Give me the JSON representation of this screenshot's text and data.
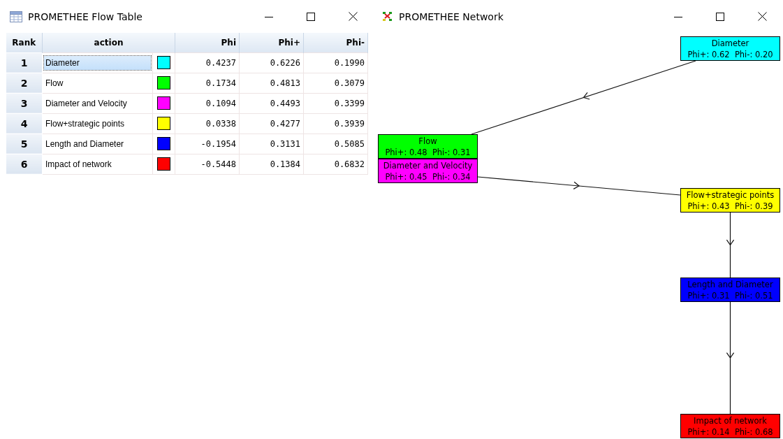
{
  "flow_window": {
    "title": "PROMETHEE Flow Table",
    "table": {
      "columns": [
        "Rank",
        "action",
        "Phi",
        "Phi+",
        "Phi-"
      ],
      "rows": [
        {
          "rank": "1",
          "action": "Diameter",
          "color": "#00ffff",
          "phi": "0.4237",
          "phi_plus": "0.6226",
          "phi_minus": "0.1990",
          "selected": true
        },
        {
          "rank": "2",
          "action": "Flow",
          "color": "#00ff00",
          "phi": "0.1734",
          "phi_plus": "0.4813",
          "phi_minus": "0.3079",
          "selected": false
        },
        {
          "rank": "3",
          "action": "Diameter and Velocity",
          "color": "#ff00ff",
          "phi": "0.1094",
          "phi_plus": "0.4493",
          "phi_minus": "0.3399",
          "selected": false
        },
        {
          "rank": "4",
          "action": "Flow+strategic points",
          "color": "#ffff00",
          "phi": "0.0338",
          "phi_plus": "0.4277",
          "phi_minus": "0.3939",
          "selected": false
        },
        {
          "rank": "5",
          "action": "Length and Diameter",
          "color": "#0000ff",
          "phi": "-0.1954",
          "phi_plus": "0.3131",
          "phi_minus": "0.5085",
          "selected": false
        },
        {
          "rank": "6",
          "action": "Impact of network",
          "color": "#ff0000",
          "phi": "-0.5448",
          "phi_plus": "0.1384",
          "phi_minus": "0.6832",
          "selected": false
        }
      ]
    }
  },
  "network_window": {
    "title": "PROMETHEE Network",
    "nodes": [
      {
        "name": "Diameter",
        "scores": "Phi+: 0.62  Phi-: 0.20",
        "color": "#00ffff"
      },
      {
        "name": "Flow",
        "scores": "Phi+: 0.48  Phi-: 0.31",
        "color": "#00ff00"
      },
      {
        "name": "Diameter and Velocity",
        "scores": "Phi+: 0.45  Phi-: 0.34",
        "color": "#ff00ff"
      },
      {
        "name": "Flow+strategic points",
        "scores": "Phi+: 0.43  Phi-: 0.39",
        "color": "#ffff00"
      },
      {
        "name": "Length and Diameter",
        "scores": "Phi+: 0.31  Phi-: 0.51",
        "color": "#0000ff"
      },
      {
        "name": "Impact of network",
        "scores": "Phi+: 0.14  Phi-: 0.68",
        "color": "#ff0000"
      }
    ]
  }
}
